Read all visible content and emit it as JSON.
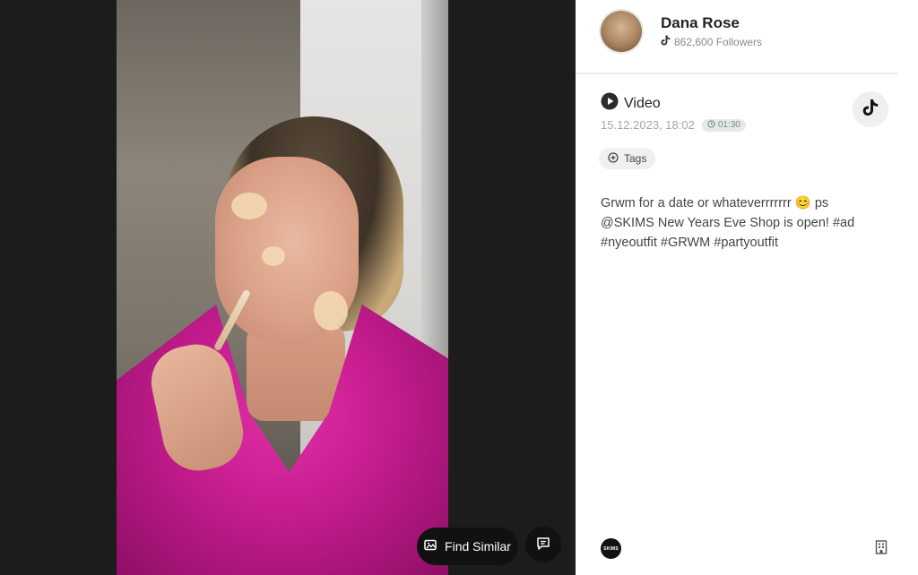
{
  "video": {
    "find_similar_label": "Find Similar"
  },
  "author": {
    "name": "Dana Rose",
    "followers": "862,600 Followers"
  },
  "post": {
    "type_label": "Video",
    "date": "15.12.2023, 18:02",
    "duration": "01:30",
    "tags_label": "Tags",
    "caption": "Grwm for a date or whateverrrrrrr 😊 ps @SKIMS New Years Eve Shop is open! #ad #nyeoutfit #GRWM #partyoutfit"
  },
  "brand": {
    "logo_text": "SKIMS"
  },
  "colors": {
    "stage_bg": "#1c1c1c",
    "robe": "#c41c8d",
    "panel_bg": "#ffffff",
    "name_text": "#222222",
    "muted_text": "#8a8a8a"
  }
}
